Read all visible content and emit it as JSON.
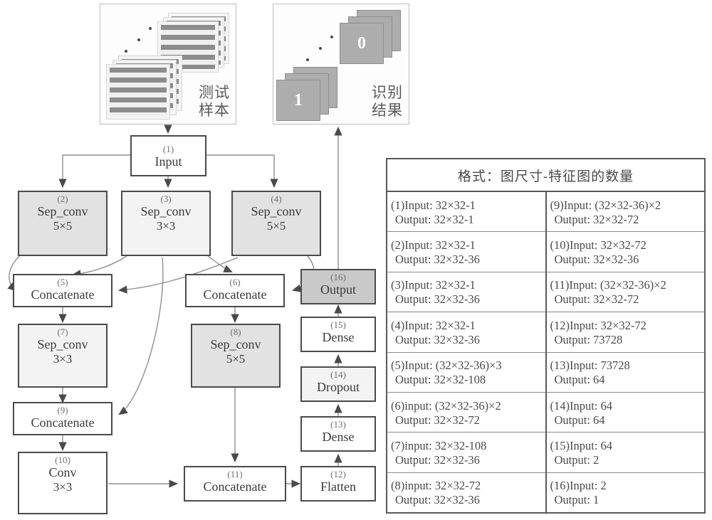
{
  "panels": {
    "samples": {
      "label": "测试\n样本",
      "name": "test-samples"
    },
    "results": {
      "label": "识别\n结果",
      "name": "recognition-results",
      "card_values": [
        "1",
        "0",
        "0",
        "0",
        "0",
        "1"
      ]
    }
  },
  "nodes": [
    {
      "id": "n1",
      "index": "(1)",
      "label": "Input",
      "sub": "",
      "shade": "white"
    },
    {
      "id": "n2",
      "index": "(2)",
      "label": "Sep_conv",
      "sub": "5×5",
      "shade": "mid"
    },
    {
      "id": "n3",
      "index": "(3)",
      "label": "Sep_conv",
      "sub": "3×3",
      "shade": "light"
    },
    {
      "id": "n4",
      "index": "(4)",
      "label": "Sep_conv",
      "sub": "5×5",
      "shade": "mid"
    },
    {
      "id": "n5",
      "index": "(5)",
      "label": "Concatenate",
      "sub": "",
      "shade": "white"
    },
    {
      "id": "n6",
      "index": "(6)",
      "label": "Concatenate",
      "sub": "",
      "shade": "white"
    },
    {
      "id": "n7",
      "index": "(7)",
      "label": "Sep_conv",
      "sub": "3×3",
      "shade": "light"
    },
    {
      "id": "n8",
      "index": "(8)",
      "label": "Sep_conv",
      "sub": "5×5",
      "shade": "mid"
    },
    {
      "id": "n9",
      "index": "(9)",
      "label": "Concatenate",
      "sub": "",
      "shade": "white"
    },
    {
      "id": "n10",
      "index": "(10)",
      "label": "Conv",
      "sub": "3×3",
      "shade": "white"
    },
    {
      "id": "n11",
      "index": "(11)",
      "label": "Concatenate",
      "sub": "",
      "shade": "white"
    },
    {
      "id": "n12",
      "index": "(12)",
      "label": "Flatten",
      "sub": "",
      "shade": "white"
    },
    {
      "id": "n13",
      "index": "(13)",
      "label": "Dense",
      "sub": "",
      "shade": "white"
    },
    {
      "id": "n14",
      "index": "(14)",
      "label": "Dropout",
      "sub": "",
      "shade": "light"
    },
    {
      "id": "n15",
      "index": "(15)",
      "label": "Dense",
      "sub": "",
      "shade": "white"
    },
    {
      "id": "n16",
      "index": "(16)",
      "label": "Output",
      "sub": "",
      "shade": "dark"
    }
  ],
  "table": {
    "header": "格式：图尺寸-特征图的数量",
    "left": [
      {
        "line1": "(1)Input: 32×32-1",
        "line2": "Output: 32×32-1"
      },
      {
        "line1": "(2)Input: 32×32-1",
        "line2": "Output: 32×32-36"
      },
      {
        "line1": "(3)Input: 32×32-1",
        "line2": "Output: 32×32-36"
      },
      {
        "line1": "(4)Input: 32×32-1",
        "line2": "Output: 32×32-36"
      },
      {
        "line1": "(5)Input: (32×32-36)×3",
        "line2": "Output: 32×32-108"
      },
      {
        "line1": "(6)input: (32×32-36)×2",
        "line2": "Output: 32×32-72"
      },
      {
        "line1": "(7)input: 32×32-108",
        "line2": "Output: 32×32-36"
      },
      {
        "line1": "(8)input: 32×32-72",
        "line2": "Output: 32×32-36"
      }
    ],
    "right": [
      {
        "line1": "(9)Input: (32×32-36)×2",
        "line2": "Output: 32×32-72"
      },
      {
        "line1": "(10)Input: 32×32-72",
        "line2": "Output: 32×32-36"
      },
      {
        "line1": "(11)Input: (32×32-36)×2",
        "line2": "Output: 32×32-72"
      },
      {
        "line1": "(12)Input: 32×32-72",
        "line2": "Output: 73728"
      },
      {
        "line1": "(13)Input: 73728",
        "line2": "Output: 64"
      },
      {
        "line1": "(14)Input: 64",
        "line2": "Output: 64"
      },
      {
        "line1": "(15)Input: 64",
        "line2": "Output: 2"
      },
      {
        "line1": "(16)Input: 2",
        "line2": "Output: 1"
      }
    ]
  },
  "colors": {
    "stroke": "#4a4a4a",
    "wire": "#8f8f8f",
    "shade_light": "#f3f3f3",
    "shade_mid": "#e2e2e2",
    "shade_dark": "#c9c9c9",
    "background": "#ffffff"
  }
}
